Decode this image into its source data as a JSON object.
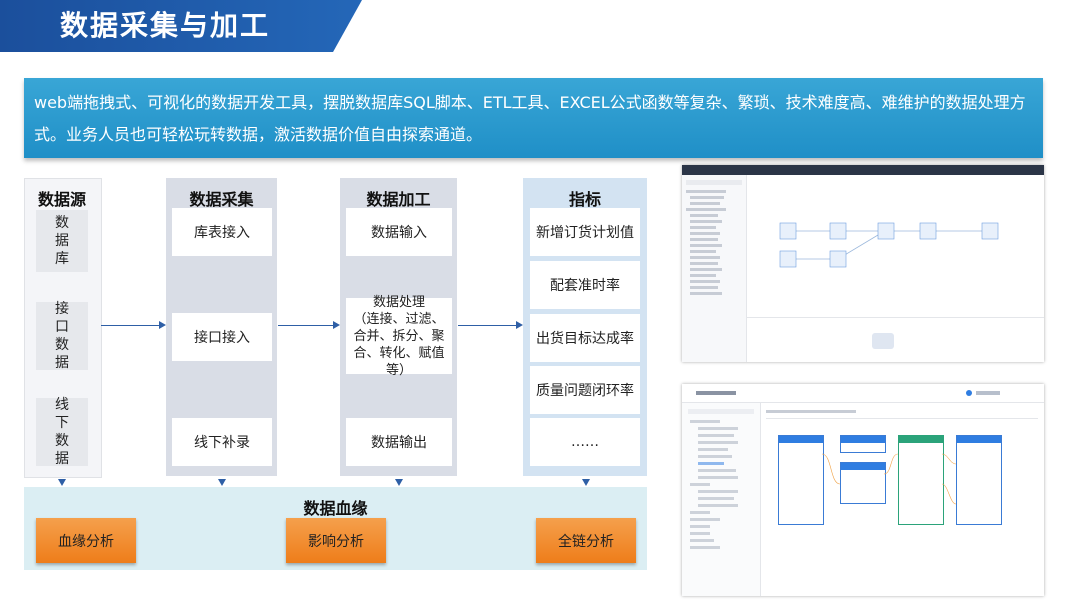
{
  "title": "数据采集与加工",
  "intro": "web端拖拽式、可视化的数据开发工具，摆脱数据库SQL脚本、ETL工具、EXCEL公式函数等复杂、繁琐、技术难度高、难维护的数据处理方式。业务人员也可轻松玩转数据，激活数据价值自由探索通道。",
  "source": {
    "heading": "数据源",
    "items": [
      "数据库",
      "接口数据",
      "线下数据"
    ]
  },
  "collect": {
    "heading": "数据采集",
    "items": [
      "库表接入",
      "接口接入",
      "线下补录"
    ]
  },
  "process": {
    "heading": "数据加工",
    "items": [
      "数据输入",
      "数据处理\n（连接、过滤、合并、拆分、聚合、转化、赋值等）",
      "数据输出"
    ]
  },
  "metrics": {
    "heading": "指标",
    "items": [
      "新增订货计划值",
      "配套准时率",
      "出货目标达成率",
      "质量问题闭环率",
      "……"
    ]
  },
  "lineage": {
    "heading": "数据血缘",
    "buttons": [
      "血缘分析",
      "影响分析",
      "全链分析"
    ]
  },
  "colors": {
    "title_bg": "#1b4f9c",
    "intro_bg": "#2c9bd0",
    "arrow": "#2e5fa6",
    "lineage_bg": "#dbeef3",
    "button": "#f08a26"
  },
  "icons": [
    "down-arrow-icon",
    "right-arrow-icon"
  ]
}
